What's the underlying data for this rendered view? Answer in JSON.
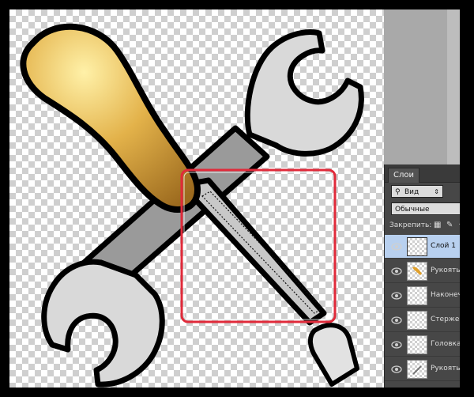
{
  "layers_panel": {
    "tab_label": "Слои",
    "filter_label": "Вид",
    "blend_mode": "Обычные",
    "lock_label": "Закрепить:",
    "lock_icons": [
      "lock-transparent-icon",
      "lock-image-icon",
      "lock-position-icon"
    ],
    "layers": [
      {
        "name": "Слой 1",
        "selected": true,
        "thumb": "empty"
      },
      {
        "name": "Рукоять от",
        "selected": false,
        "thumb": "handle"
      },
      {
        "name": "Наконечни",
        "selected": false,
        "thumb": "empty"
      },
      {
        "name": "Стержень",
        "selected": false,
        "thumb": "empty"
      },
      {
        "name": "Головка кл",
        "selected": false,
        "thumb": "empty"
      },
      {
        "name": "Рукоять кл",
        "selected": false,
        "thumb": "wrench"
      }
    ]
  },
  "colors": {
    "selection_highlight": "#e02a3a",
    "handle_gold": "#d9a53a",
    "wrench_gray": "#9a9a9a",
    "panel_bg": "#474747",
    "selected_layer": "#b8d0ef"
  }
}
